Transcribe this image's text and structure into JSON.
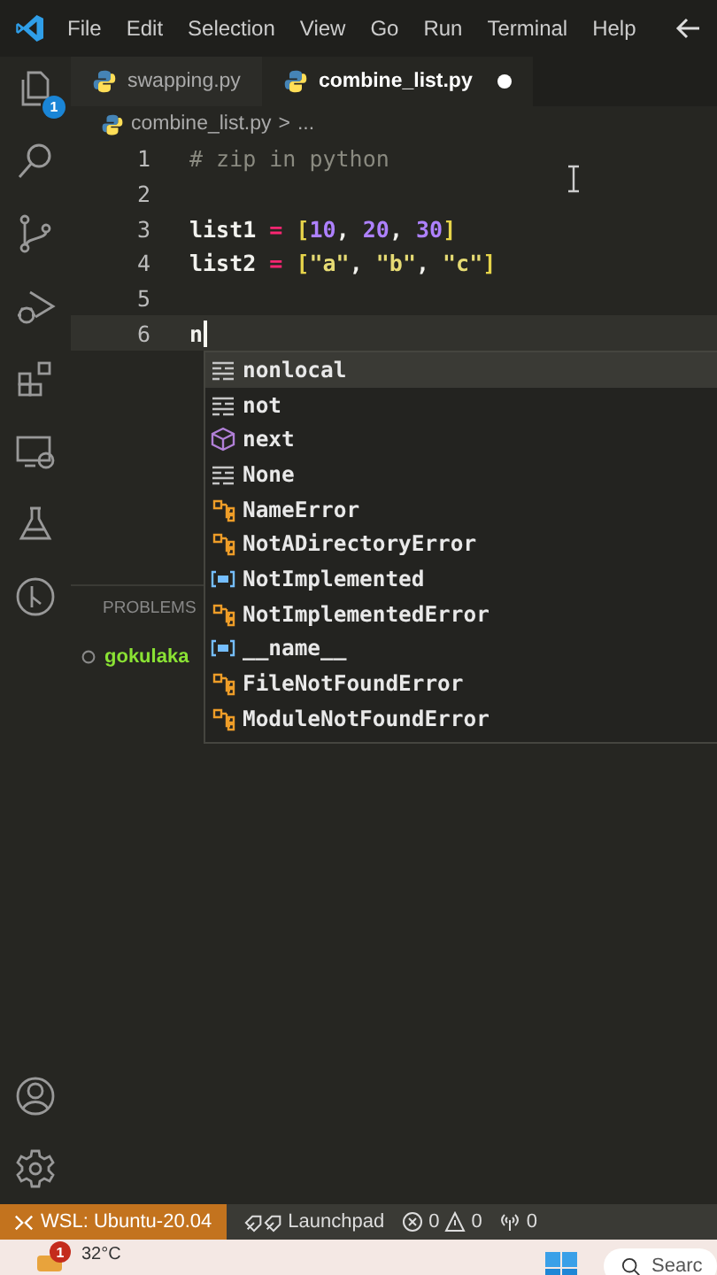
{
  "menu": [
    "File",
    "Edit",
    "Selection",
    "View",
    "Go",
    "Run",
    "Terminal",
    "Help"
  ],
  "activity_badge": "1",
  "tabs": [
    {
      "label": "swapping.py",
      "selected": false,
      "modified": false
    },
    {
      "label": "combine_list.py",
      "selected": true,
      "modified": true
    }
  ],
  "breadcrumb": {
    "file": "combine_list.py",
    "separator": ">",
    "rest": "..."
  },
  "lines": [
    {
      "number": "1",
      "current": false,
      "tokens": [
        {
          "kind": "comment",
          "text": "# zip in python"
        }
      ]
    },
    {
      "number": "2",
      "current": false
    },
    {
      "number": "3",
      "current": false,
      "tokens": [
        {
          "kind": "ident",
          "text": "list1"
        },
        {
          "kind": "op",
          "text": " = "
        },
        {
          "kind": "bracket",
          "text": "["
        },
        {
          "kind": "number",
          "text": "10"
        },
        {
          "kind": "plain",
          "text": ", "
        },
        {
          "kind": "number",
          "text": "20"
        },
        {
          "kind": "plain",
          "text": ", "
        },
        {
          "kind": "number",
          "text": "30"
        },
        {
          "kind": "bracket",
          "text": "]"
        }
      ]
    },
    {
      "number": "4",
      "current": false,
      "tokens": [
        {
          "kind": "ident",
          "text": "list2"
        },
        {
          "kind": "op",
          "text": " = "
        },
        {
          "kind": "bracket",
          "text": "["
        },
        {
          "kind": "string",
          "text": "\"a\""
        },
        {
          "kind": "plain",
          "text": ", "
        },
        {
          "kind": "string",
          "text": "\"b\""
        },
        {
          "kind": "plain",
          "text": ", "
        },
        {
          "kind": "string",
          "text": "\"c\""
        },
        {
          "kind": "bracket",
          "text": "]"
        }
      ]
    },
    {
      "number": "5",
      "current": false
    },
    {
      "number": "6",
      "current": true,
      "tokens": [
        {
          "kind": "ident",
          "text": "n"
        }
      ]
    }
  ],
  "suggestions": [
    {
      "kind": "keyword",
      "label": "nonlocal",
      "selected": true
    },
    {
      "kind": "keyword",
      "label": "not",
      "selected": false
    },
    {
      "kind": "module",
      "label": "next",
      "selected": false
    },
    {
      "kind": "keyword",
      "label": "None",
      "selected": false
    },
    {
      "kind": "class",
      "label": "NameError",
      "selected": false
    },
    {
      "kind": "class",
      "label": "NotADirectoryError",
      "selected": false
    },
    {
      "kind": "variable",
      "label": "NotImplemented",
      "selected": false
    },
    {
      "kind": "class",
      "label": "NotImplementedError",
      "selected": false
    },
    {
      "kind": "variable",
      "label": "__name__",
      "selected": false
    },
    {
      "kind": "class",
      "label": "FileNotFoundError",
      "selected": false
    },
    {
      "kind": "class",
      "label": "ModuleNotFoundError",
      "selected": false
    }
  ],
  "panel": {
    "tab": "PROBLEMS",
    "terminal_line": "gokulaka"
  },
  "status_bar": {
    "remote": "WSL: Ubuntu-20.04",
    "launchpad": "Launchpad",
    "errors": "0",
    "warnings": "0",
    "ports": "0"
  },
  "taskbar": {
    "weather_badge": "1",
    "temperature": "32°C",
    "search": "Searc"
  }
}
